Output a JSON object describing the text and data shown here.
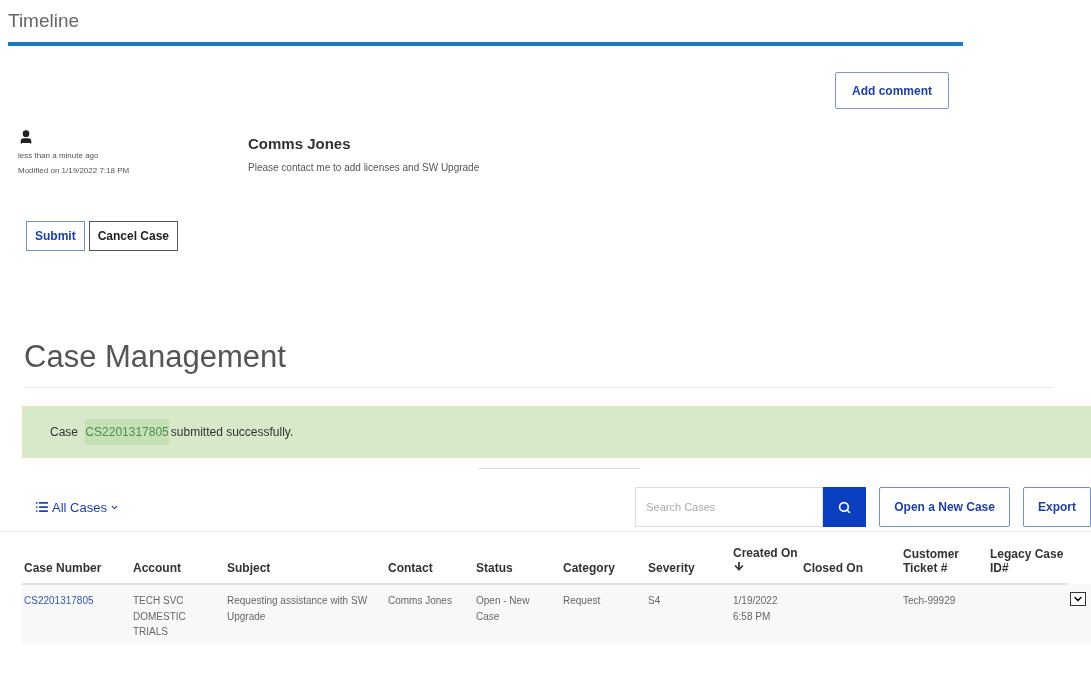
{
  "timeline": {
    "title": "Timeline",
    "add_button": "Add comment",
    "comment": {
      "time": "less than a minute ago",
      "modified": "Modified on 1/19/2022 7:18 PM",
      "author": "Comms Jones",
      "text": "Please contact me to add licenses and SW Upgrade"
    },
    "buttons": [
      {
        "label": "Submit",
        "kind": "primary"
      },
      {
        "label": "Cancel Case",
        "kind": "secondary"
      }
    ]
  },
  "case_management": {
    "title": "Case Management",
    "alert": {
      "prefix": "Case",
      "link": "CS2201317805",
      "suffix": "submitted successfully."
    },
    "view_menu": "All Cases",
    "search": {
      "placeholder": "Search Cases"
    },
    "actions": [
      "Open a New Case",
      "Export"
    ],
    "table": {
      "columns": [
        {
          "label": "Case Number",
          "sorted": false
        },
        {
          "label": "Account",
          "sorted": false
        },
        {
          "label": "Subject",
          "sorted": false
        },
        {
          "label": "Contact",
          "sorted": false
        },
        {
          "label": "Status",
          "sorted": false
        },
        {
          "label": "Category",
          "sorted": false
        },
        {
          "label": "Severity",
          "sorted": false
        },
        {
          "label": "Created On",
          "sorted": true
        },
        {
          "label": "Closed On",
          "sorted": false
        },
        {
          "label": "Customer Ticket #",
          "sorted": false
        },
        {
          "label": "Legacy Case ID#",
          "sorted": false
        }
      ],
      "rows": [
        {
          "cells": [
            "CS2201317805",
            "TECH SVC DOMESTIC TRIALS",
            "Requesting assistance with SW Upgrade",
            "Comms Jones",
            "Open - New Case",
            "Request",
            "S4",
            "1/19/2022 6:58 PM",
            "",
            "Tech-99929",
            ""
          ]
        }
      ]
    }
  }
}
